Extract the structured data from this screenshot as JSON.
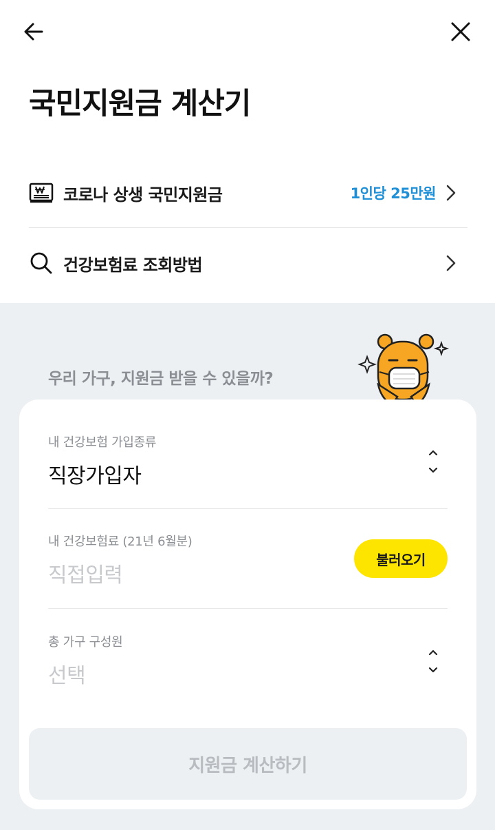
{
  "header": {
    "back_icon": "arrow-left-icon",
    "close_icon": "close-icon",
    "title": "국민지원금 계산기"
  },
  "menu": {
    "items": [
      {
        "icon": "wallet-won-icon",
        "label": "코로나 상생 국민지원금",
        "value": "1인당 25만원"
      },
      {
        "icon": "search-icon",
        "label": "건강보험료 조회방법",
        "value": ""
      }
    ]
  },
  "form": {
    "question": "우리 가구, 지원금 받을 수 있을까?",
    "insurance_type": {
      "label": "내 건강보험 가입종류",
      "value": "직장가입자"
    },
    "insurance_fee": {
      "label": "내 건강보험료 (21년 6월분)",
      "placeholder": "직접입력",
      "load_button": "불러오기"
    },
    "household": {
      "label": "총 가구 구성원",
      "placeholder": "선택"
    },
    "submit_label": "지원금 계산하기"
  },
  "colors": {
    "accent_yellow": "#fee500",
    "link_blue": "#1f8fd6",
    "panel_bg": "#edf0f3"
  }
}
